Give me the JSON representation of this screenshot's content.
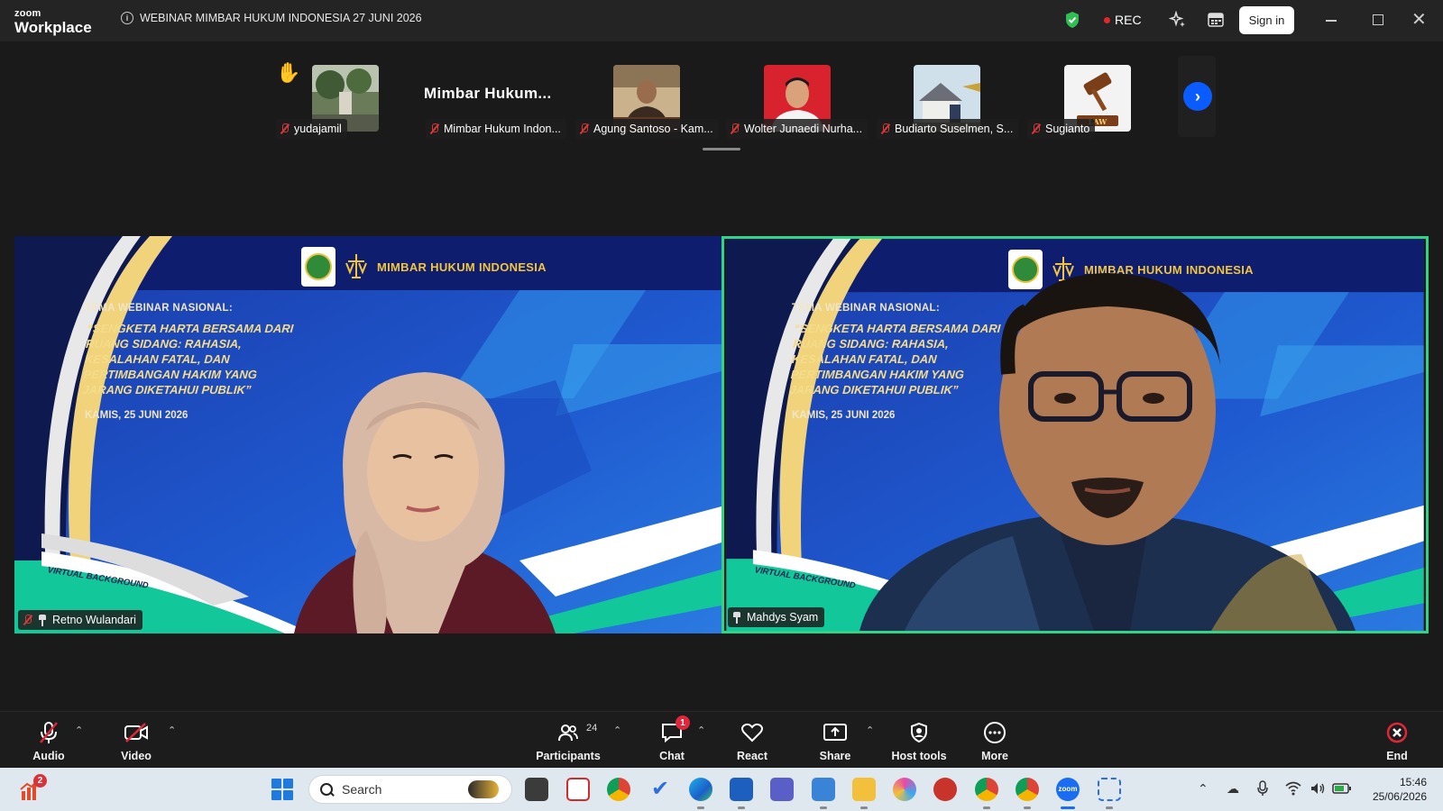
{
  "app": {
    "brand_top": "zoom",
    "brand_bottom": "Workplace",
    "meeting_title": "WEBINAR MIMBAR HUKUM INDONESIA 27 JUNI 2026"
  },
  "titlebar": {
    "rec_label": "REC",
    "signin_label": "Sign in"
  },
  "strip": {
    "name_card": "Mimbar  Hukum...",
    "participants": [
      {
        "name": "yudajamil",
        "photo": "garden-photo"
      },
      {
        "name": "Mimbar Hukum Indon...",
        "photo": "name-only"
      },
      {
        "name": "Agung Santoso - Kam...",
        "photo": "person-photo"
      },
      {
        "name": "Wolter Junaedi Nurha...",
        "photo": "person-red-photo"
      },
      {
        "name": "Budiarto Suselmen, S...",
        "photo": "house-photo"
      },
      {
        "name": "Sugianto",
        "photo": "gavel-photo"
      }
    ],
    "gavel_text": "LAW"
  },
  "banner": {
    "org": "MIMBAR HUKUM INDONESIA",
    "theme_label": "TEMA WEBINAR NASIONAL:",
    "theme_lines": [
      "“SENGKETA HARTA BERSAMA DARI",
      "RUANG SIDANG: RAHASIA,",
      "KESALAHAN FATAL, DAN",
      "PERTIMBANGAN HAKIM YANG",
      "JARANG DIKETAHUI PUBLIK”"
    ],
    "date": "KAMIS, 25 JUNI 2026",
    "virtual_bg": "VIRTUAL BACKGROUND"
  },
  "videos": [
    {
      "name": "Retno Wulandari",
      "muted": true,
      "pinned": true
    },
    {
      "name": "Mahdys Syam",
      "muted": false,
      "pinned": true,
      "active_speaker": true
    }
  ],
  "toolbar": {
    "audio": "Audio",
    "video": "Video",
    "participants": "Participants",
    "participants_count": "24",
    "chat": "Chat",
    "chat_badge": "1",
    "react": "React",
    "share": "Share",
    "host_tools": "Host tools",
    "more": "More",
    "end": "End"
  },
  "taskbar": {
    "search_placeholder": "Search",
    "notification_badge": "2",
    "time": "15:46",
    "date": "25/06/2026"
  },
  "colors": {
    "active_speaker_border": "#2fd587",
    "accent_blue": "#0b5cff",
    "rec_red": "#e02828",
    "banner_gold": "#f2c53d"
  }
}
